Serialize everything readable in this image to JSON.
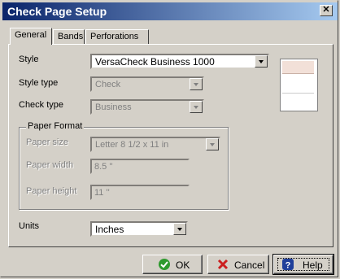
{
  "window": {
    "title": "Check Page Setup",
    "close_label": "✕"
  },
  "tabs": [
    "General",
    "Bands",
    "Perforations"
  ],
  "fields": {
    "style": {
      "label": "Style",
      "value": "VersaCheck Business 1000"
    },
    "style_type": {
      "label": "Style type",
      "value": "Check"
    },
    "check_type": {
      "label": "Check type",
      "value": "Business"
    },
    "paper_format": {
      "label": "Paper Format"
    },
    "paper_size": {
      "label": "Paper size",
      "value": "Letter 8 1/2 x 11 in"
    },
    "paper_width": {
      "label": "Paper width",
      "value": "8.5 ''"
    },
    "paper_height": {
      "label": "Paper height",
      "value": "11 ''"
    },
    "units": {
      "label": "Units",
      "value": "Inches"
    }
  },
  "buttons": {
    "ok": "OK",
    "cancel": "Cancel",
    "help": "Help"
  },
  "colors": {
    "titlebar_start": "#0a246a",
    "titlebar_end": "#a6caf0",
    "face": "#d4d0c8",
    "ok_icon": "#2e9a2e",
    "cancel_icon": "#cc1f1f",
    "help_icon": "#1f3f9a"
  }
}
